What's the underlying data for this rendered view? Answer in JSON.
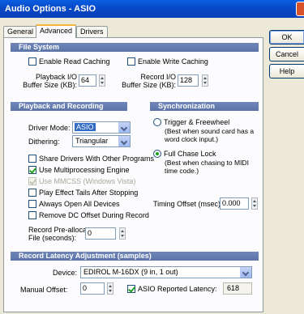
{
  "window": {
    "title": "Audio Options - ASIO"
  },
  "tabs": [
    {
      "label": "General"
    },
    {
      "label": "Advanced",
      "active": true
    },
    {
      "label": "Drivers"
    }
  ],
  "buttons": {
    "ok": "OK",
    "cancel": "Cancel",
    "help": "Help"
  },
  "file_system": {
    "header": "File System",
    "enable_read_caching": {
      "label": "Enable Read Caching",
      "checked": false
    },
    "enable_write_caching": {
      "label": "Enable Write Caching",
      "checked": false
    },
    "playback_buffer": {
      "label_line1": "Playback I/O",
      "label_line2": "Buffer Size (KB):",
      "value": "64"
    },
    "record_buffer": {
      "label_line1": "Record I/O",
      "label_line2": "Buffer Size (KB):",
      "value": "128"
    }
  },
  "playback_recording": {
    "header": "Playback and Recording",
    "driver_mode": {
      "label": "Driver Mode:",
      "value": "ASIO"
    },
    "dithering": {
      "label": "Dithering:",
      "value": "Triangular"
    },
    "options": [
      {
        "label": "Share Drivers With Other Programs",
        "checked": false,
        "disabled": false
      },
      {
        "label": "Use Multiprocessing Engine",
        "checked": true,
        "disabled": false
      },
      {
        "label": "Use MMCSS (Windows Vista)",
        "checked": true,
        "disabled": true
      },
      {
        "label": "Play Effect Tails After Stopping",
        "checked": false,
        "disabled": false
      },
      {
        "label": "Always Open All Devices",
        "checked": false,
        "disabled": false
      },
      {
        "label": "Remove DC Offset During Record",
        "checked": false,
        "disabled": false
      }
    ],
    "preallocate": {
      "label_line1": "Record Pre-allocate",
      "label_line2": "File (seconds):",
      "value": "0"
    }
  },
  "synchronization": {
    "header": "Synchronization",
    "trigger_freewheel": {
      "label": "Trigger & Freewheel",
      "note_line1": "(Best when sound card has a",
      "note_line2": "word clock input.)",
      "selected": false
    },
    "full_chase_lock": {
      "label": "Full Chase Lock",
      "note_line1": "(Best when chasing to MIDI",
      "note_line2": "time code.)",
      "selected": true
    },
    "timing_offset": {
      "label": "Timing Offset (msec):",
      "value": "0.000"
    }
  },
  "latency": {
    "header": "Record Latency Adjustment (samples)",
    "device": {
      "label": "Device:",
      "value": "EDIROL M-16DX (9 in, 1 out)"
    },
    "manual_offset": {
      "label": "Manual Offset:",
      "value": "0"
    },
    "asio_reported": {
      "label": "ASIO Reported Latency:",
      "checked": true,
      "value": "618"
    }
  },
  "colors": {
    "title_bar": "#0a5fe0",
    "section_header": "#6f86b8",
    "selection": "#316ac5",
    "dialog_bg": "#ece9d8"
  }
}
